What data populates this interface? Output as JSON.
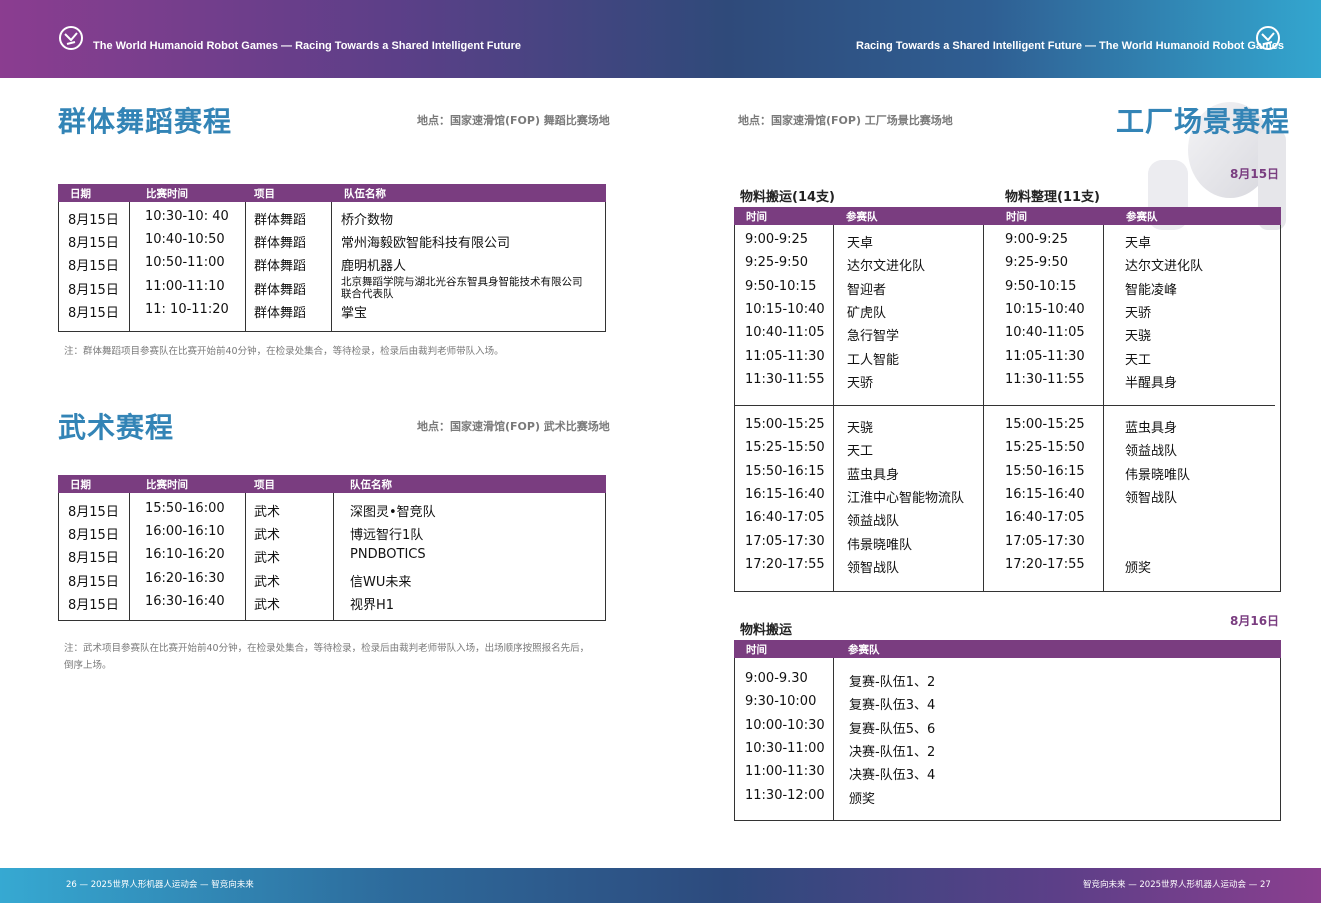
{
  "header": {
    "left_text": "The World Humanoid Robot Games — Racing Towards a Shared Intelligent Future",
    "right_text": "Racing Towards a Shared Intelligent Future — The World Humanoid Robot Games"
  },
  "footer": {
    "left_text": "26  —  2025世界人形机器人运动会  —  智竞向未来",
    "right_text": "智竞向未来  —  2025世界人形机器人运动会  —  27"
  },
  "dance": {
    "title": "群体舞蹈赛程",
    "venue": "地点：国家速滑馆(FOP) 舞蹈比赛场地",
    "headers": [
      "日期",
      "比赛时间",
      "项目",
      "队伍名称"
    ],
    "rows": [
      [
        "8月15日",
        "10:30-10: 40",
        "群体舞蹈",
        "桥介数物"
      ],
      [
        "8月15日",
        "10:40-10:50",
        "群体舞蹈",
        "常州海毅欧智能科技有限公司"
      ],
      [
        "8月15日",
        "10:50-11:00",
        "群体舞蹈",
        "鹿明机器人"
      ],
      [
        "8月15日",
        "11:00-11:10",
        "群体舞蹈",
        "北京舞蹈学院与湖北光谷东智具身智能技术有限公司"
      ],
      [
        "8月15日",
        "11: 10-11:20",
        "群体舞蹈",
        "掌宝"
      ]
    ],
    "row4_line2": "联合代表队",
    "note": "注：群体舞蹈项目参赛队在比赛开始前40分钟，在检录处集合，等待检录，检录后由裁判老师带队入场。"
  },
  "wushu": {
    "title": "武术赛程",
    "venue": "地点：国家速滑馆(FOP) 武术比赛场地",
    "headers": [
      "日期",
      "比赛时间",
      "项目",
      "队伍名称"
    ],
    "rows": [
      [
        "8月15日",
        "15:50-16:00",
        "武术",
        "深图灵•智竞队"
      ],
      [
        "8月15日",
        "16:00-16:10",
        "武术",
        "博远智行1队"
      ],
      [
        "8月15日",
        "16:10-16:20",
        "武术",
        "PNDBOTICS"
      ],
      [
        "8月15日",
        "16:20-16:30",
        "武术",
        "信WU未来"
      ],
      [
        "8月15日",
        "16:30-16:40",
        "武术",
        "视界H1"
      ]
    ],
    "note_line1": "注：武术项目参赛队在比赛开始前40分钟，在检录处集合，等待检录，检录后由裁判老师带队入场，出场顺序按照报名先后，",
    "note_line2": "倒序上场。"
  },
  "factory": {
    "title": "工厂场景赛程",
    "venue": "地点：国家速滑馆(FOP) 工厂场景比赛场地",
    "day1_label": "8月15日",
    "day2_label": "8月16日",
    "sub_a": "物料搬运(14支)",
    "sub_b": "物料整理(11支)",
    "sub_c": "物料搬运",
    "col_time": "时间",
    "col_team": "参赛队",
    "a_morning": [
      [
        "9:00-9:25",
        "天卓"
      ],
      [
        "9:25-9:50",
        "达尔文进化队"
      ],
      [
        "9:50-10:15",
        "智迎者"
      ],
      [
        "10:15-10:40",
        "矿虎队"
      ],
      [
        "10:40-11:05",
        "急行智学"
      ],
      [
        "11:05-11:30",
        "工人智能"
      ],
      [
        "11:30-11:55",
        "天骄"
      ]
    ],
    "a_afternoon": [
      [
        "15:00-15:25",
        "天骁"
      ],
      [
        "15:25-15:50",
        "天工"
      ],
      [
        "15:50-16:15",
        "蓝虫具身"
      ],
      [
        "16:15-16:40",
        "江淮中心智能物流队"
      ],
      [
        "16:40-17:05",
        "领益战队"
      ],
      [
        "17:05-17:30",
        "伟景晓唯队"
      ],
      [
        "17:20-17:55",
        "领智战队"
      ]
    ],
    "b_morning": [
      [
        "9:00-9:25",
        "天卓"
      ],
      [
        "9:25-9:50",
        "达尔文进化队"
      ],
      [
        "9:50-10:15",
        "智能凌峰"
      ],
      [
        "10:15-10:40",
        "天骄"
      ],
      [
        "10:40-11:05",
        "天骁"
      ],
      [
        "11:05-11:30",
        "天工"
      ],
      [
        "11:30-11:55",
        "半醒具身"
      ]
    ],
    "b_afternoon": [
      [
        "15:00-15:25",
        "蓝虫具身"
      ],
      [
        "15:25-15:50",
        "领益战队"
      ],
      [
        "15:50-16:15",
        "伟景晓唯队"
      ],
      [
        "16:15-16:40",
        "领智战队"
      ],
      [
        "16:40-17:05",
        ""
      ],
      [
        "17:05-17:30",
        ""
      ],
      [
        "17:20-17:55",
        "颁奖"
      ]
    ],
    "c_rows": [
      [
        "9:00-9.30",
        "复赛-队伍1、2"
      ],
      [
        "9:30-10:00",
        "复赛-队伍3、4"
      ],
      [
        "10:00-10:30",
        "复赛-队伍5、6"
      ],
      [
        "10:30-11:00",
        "决赛-队伍1、2"
      ],
      [
        "11:00-11:30",
        "决赛-队伍3、4"
      ],
      [
        "11:30-12:00",
        "颁奖"
      ]
    ]
  }
}
